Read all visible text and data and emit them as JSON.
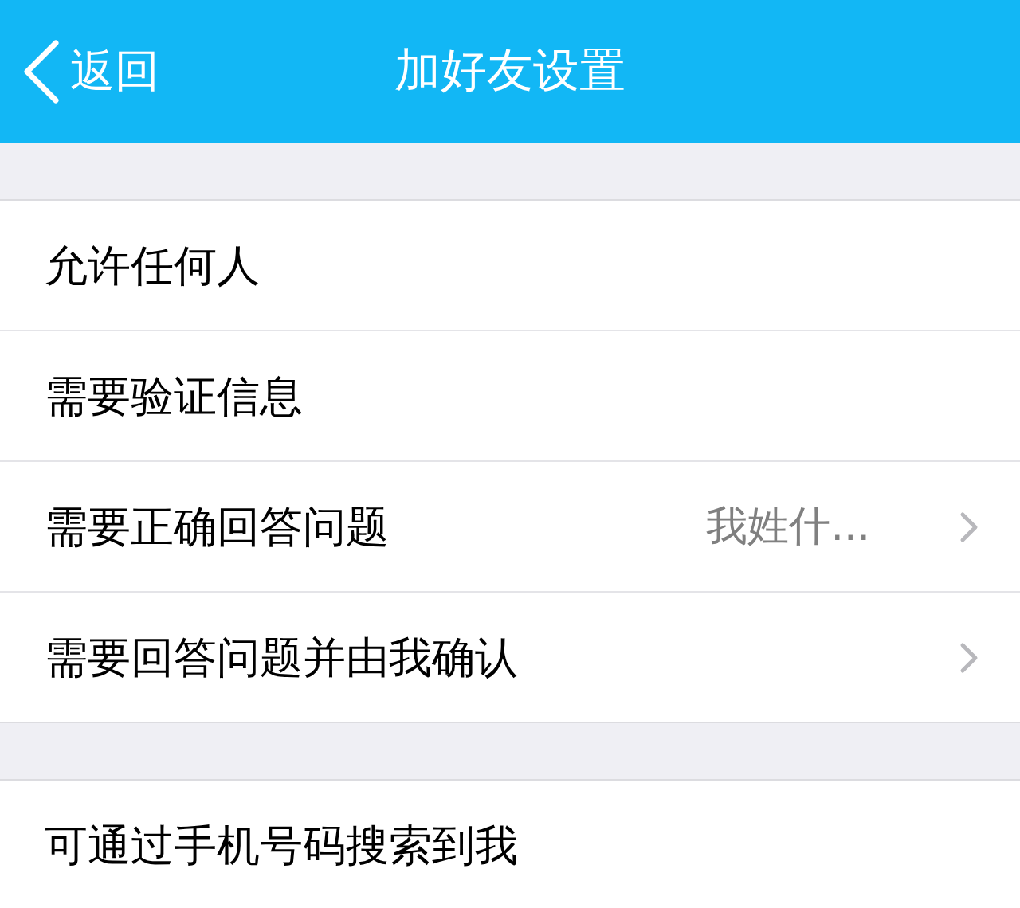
{
  "nav_bar": {
    "back": "返回",
    "title": "加好友设置"
  },
  "sections": [
    {
      "rows": [
        {
          "label": "允许任何人",
          "chevron": false
        },
        {
          "label": "需要验证信息",
          "chevron": false
        },
        {
          "label": "需要正确回答问题",
          "value": "我姓什...",
          "chevron": true
        },
        {
          "label": "需要回答问题并由我确认",
          "chevron": true
        }
      ]
    },
    {
      "rows": [
        {
          "label": "可通过手机号码搜索到我",
          "chevron": false
        }
      ]
    }
  ]
}
